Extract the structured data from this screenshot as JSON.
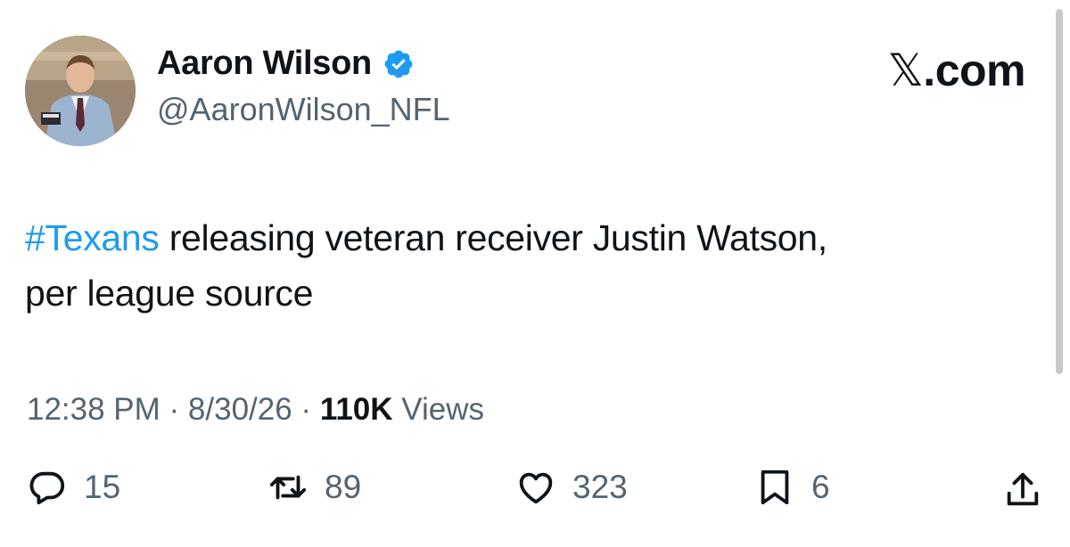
{
  "author": {
    "name": "Aaron Wilson",
    "handle": "@AaronWilson_NFL",
    "verified_icon": "verified-badge-icon",
    "verified_color": "#1d9bf0"
  },
  "brand": {
    "symbol": "𝕏",
    "suffix": ".com"
  },
  "tweet": {
    "hashtag": "#Texans",
    "text_after_hashtag": " releasing veteran receiver Justin Watson,",
    "text_line2": "per league source"
  },
  "meta": {
    "time": "12:38 PM",
    "sep1": " · ",
    "date": "8/30/26",
    "sep2": " · ",
    "views_count": "110K",
    "views_label": " Views"
  },
  "actions": {
    "replies": "15",
    "reposts": "89",
    "likes": "323",
    "bookmarks": "6"
  },
  "colors": {
    "text": "#0f1419",
    "secondary": "#536471",
    "accent": "#1d9bf0"
  }
}
